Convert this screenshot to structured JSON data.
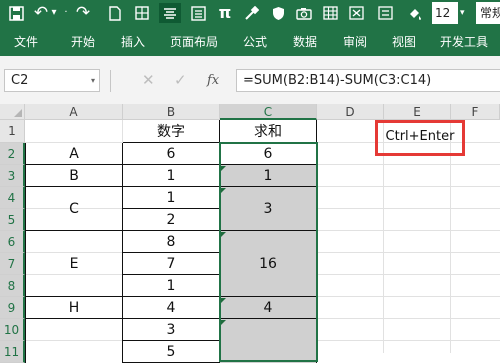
{
  "quick_access": {
    "undo_icon": "↶",
    "undo_dropdown": "▾",
    "redo_icon": "↷",
    "pi_icon": "π",
    "font_size": "12",
    "font_size_dropdown": "▾",
    "font_name": "常规"
  },
  "ribbon_tabs": [
    "文件",
    "开始",
    "插入",
    "页面布局",
    "公式",
    "数据",
    "审阅",
    "视图",
    "开发工具"
  ],
  "formula_bar": {
    "name_box": "C2",
    "name_box_dropdown": "▾",
    "cancel_icon": "✕",
    "enter_icon": "✓",
    "fx_label": "fx",
    "formula": "=SUM(B2:B14)-SUM(C3:C14)"
  },
  "grid": {
    "columns": [
      "A",
      "B",
      "C",
      "D",
      "E",
      "F"
    ],
    "rows": [
      "1",
      "2",
      "3",
      "4",
      "5",
      "6",
      "7",
      "8",
      "9",
      "10",
      "11"
    ],
    "header_b": "数字",
    "header_c": "求和",
    "col_a": [
      "A",
      "B",
      "C",
      "E",
      "H"
    ],
    "col_b": [
      "6",
      "1",
      "1",
      "2",
      "8",
      "7",
      "1",
      "4",
      "3",
      "5"
    ],
    "col_c": [
      "6",
      "1",
      "3",
      "16",
      "4"
    ]
  },
  "annotation": "Ctrl+Enter",
  "colors": {
    "accent": "#217346",
    "selected_fill": "#d0d0d0",
    "highlight_box": "#e53935"
  }
}
